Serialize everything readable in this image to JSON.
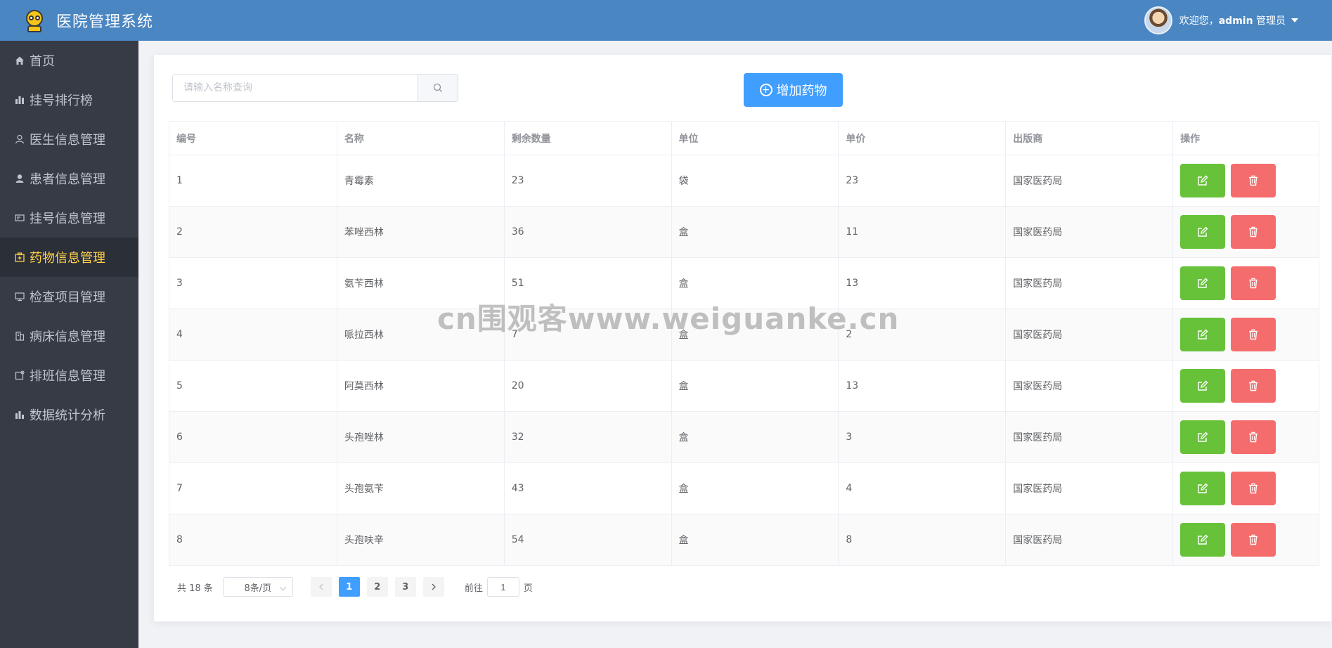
{
  "header": {
    "title": "医院管理系统",
    "welcome_prefix": "欢迎您，",
    "username": "admin",
    "role": "管理员"
  },
  "sidebar": {
    "items": [
      {
        "label": "首页",
        "icon": "home-icon"
      },
      {
        "label": "挂号排行榜",
        "icon": "bar-chart-icon"
      },
      {
        "label": "医生信息管理",
        "icon": "user-icon"
      },
      {
        "label": "患者信息管理",
        "icon": "user-solid-icon"
      },
      {
        "label": "挂号信息管理",
        "icon": "ticket-icon"
      },
      {
        "label": "药物信息管理",
        "icon": "medicine-box-icon",
        "active": true
      },
      {
        "label": "检查项目管理",
        "icon": "monitor-icon"
      },
      {
        "label": "病床信息管理",
        "icon": "bed-icon"
      },
      {
        "label": "排班信息管理",
        "icon": "schedule-icon"
      },
      {
        "label": "数据统计分析",
        "icon": "chart-icon"
      }
    ]
  },
  "search": {
    "placeholder": "请输入名称查询"
  },
  "toolbar": {
    "add_label": "增加药物"
  },
  "table": {
    "headers": [
      "编号",
      "名称",
      "剩余数量",
      "单位",
      "单价",
      "出版商",
      "操作"
    ],
    "rows": [
      [
        "1",
        "青霉素",
        "23",
        "袋",
        "23",
        "国家医药局"
      ],
      [
        "2",
        "苯唑西林",
        "36",
        "盒",
        "11",
        "国家医药局"
      ],
      [
        "3",
        "氨苄西林",
        "51",
        "盒",
        "13",
        "国家医药局"
      ],
      [
        "4",
        "哌拉西林",
        "7",
        "盒",
        "2",
        "国家医药局"
      ],
      [
        "5",
        "阿莫西林",
        "20",
        "盒",
        "13",
        "国家医药局"
      ],
      [
        "6",
        "头孢唑林",
        "32",
        "盒",
        "3",
        "国家医药局"
      ],
      [
        "7",
        "头孢氨苄",
        "43",
        "盒",
        "4",
        "国家医药局"
      ],
      [
        "8",
        "头孢呋辛",
        "54",
        "盒",
        "8",
        "国家医药局"
      ]
    ]
  },
  "pagination": {
    "total": "共 18 条",
    "page_size": "8条/页",
    "pages": [
      "1",
      "2",
      "3"
    ],
    "current": "1",
    "goto_prefix": "前往",
    "goto_value": "1",
    "goto_suffix": "页"
  },
  "watermark": "cn围观客www.weiguanke.cn",
  "colors": {
    "header_bg": "#4a86c2",
    "sidebar_bg": "#363b46",
    "active_text": "#ffd04b",
    "primary": "#409eff",
    "edit": "#67c23a",
    "delete": "#f56c6c"
  }
}
